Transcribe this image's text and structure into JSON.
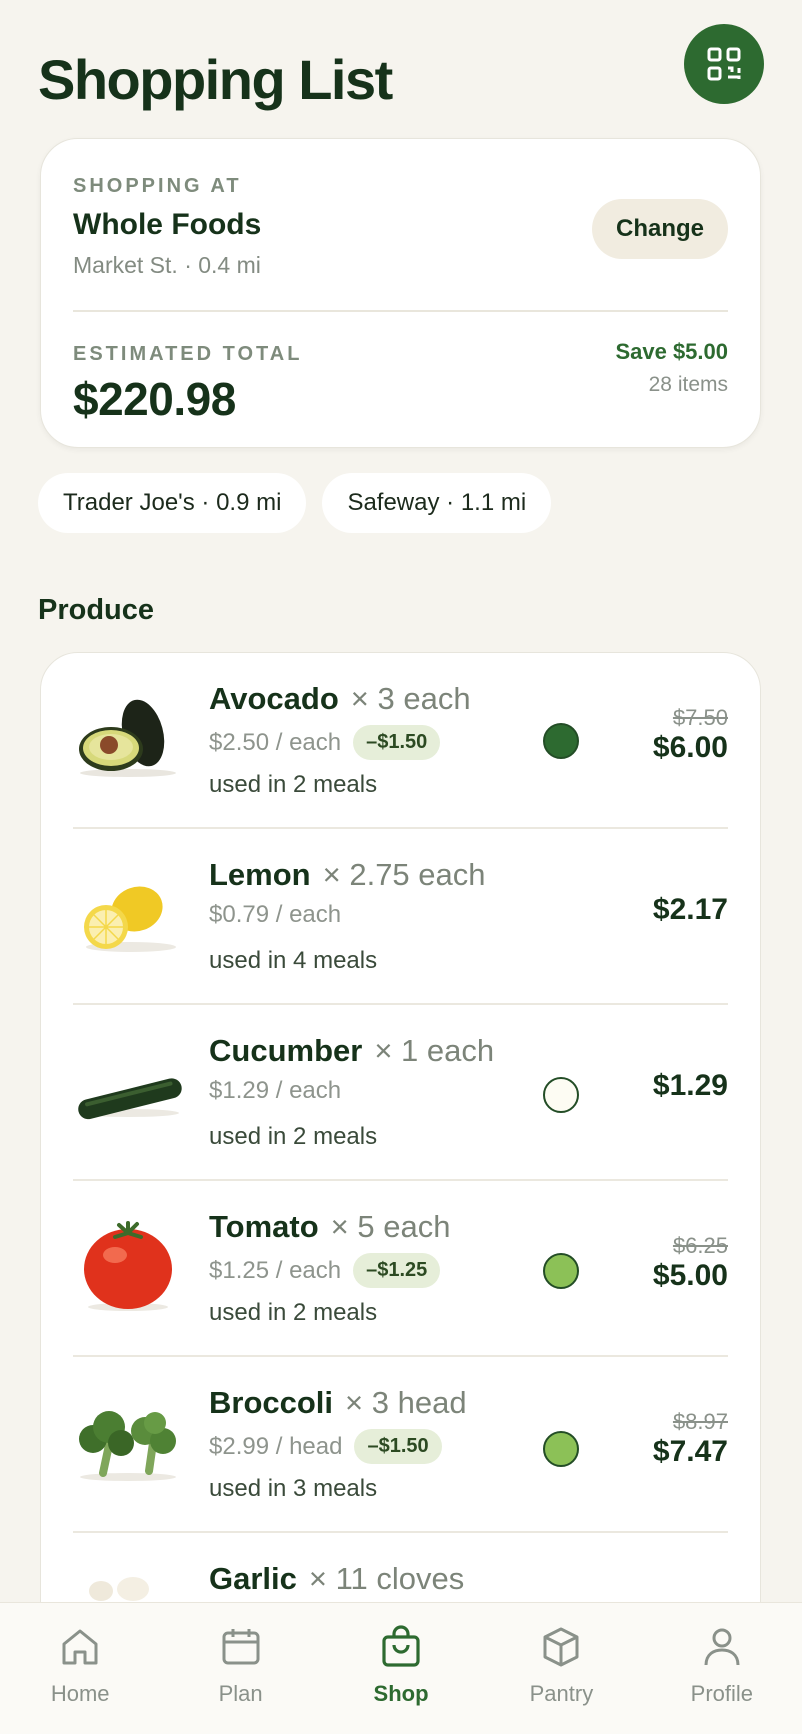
{
  "header": {
    "title": "Shopping List",
    "qr_icon": "qr-code-icon"
  },
  "store_card": {
    "eyebrow": "SHOPPING AT",
    "store_name": "Whole Foods",
    "store_sub": "Market St. · 0.4 mi",
    "change_label": "Change",
    "total_eyebrow": "ESTIMATED TOTAL",
    "total": "$220.98",
    "savings": "Save $5.00",
    "items_count": "28 items"
  },
  "alt_stores": [
    "Trader Joe's · 0.9 mi",
    "Safeway · 1.1 mi"
  ],
  "section": {
    "title": "Produce"
  },
  "items": [
    {
      "name": "Avocado",
      "qty": "× 3 each",
      "unit_price": "$2.50 / each",
      "discount": "–$1.50",
      "meals": "used in 2 meals",
      "status": "filled-dark",
      "old_price": "$7.50",
      "price": "$6.00"
    },
    {
      "name": "Lemon",
      "qty": "× 2.75 each",
      "unit_price": "$0.79 / each",
      "discount": "",
      "meals": "used in 4 meals",
      "status": "none",
      "old_price": "",
      "price": "$2.17"
    },
    {
      "name": "Cucumber",
      "qty": "× 1 each",
      "unit_price": "$1.29 / each",
      "discount": "",
      "meals": "used in 2 meals",
      "status": "empty",
      "old_price": "",
      "price": "$1.29"
    },
    {
      "name": "Tomato",
      "qty": "× 5 each",
      "unit_price": "$1.25 / each",
      "discount": "–$1.25",
      "meals": "used in 2 meals",
      "status": "filled-light",
      "old_price": "$6.25",
      "price": "$5.00"
    },
    {
      "name": "Broccoli",
      "qty": "× 3 head",
      "unit_price": "$2.99 / head",
      "discount": "–$1.50",
      "meals": "used in 3 meals",
      "status": "filled-light",
      "old_price": "$8.97",
      "price": "$7.47"
    },
    {
      "name": "Garlic",
      "qty": "× 11 cloves"
    }
  ],
  "colors": {
    "accent": "#2d6a30",
    "status_dark": "#2d6a30",
    "status_light": "#8cc157",
    "status_empty": "#fdfcf3"
  },
  "tabs": [
    {
      "label": "Home",
      "icon": "home-icon",
      "active": false
    },
    {
      "label": "Plan",
      "icon": "calendar-icon",
      "active": false
    },
    {
      "label": "Shop",
      "icon": "shopping-bag-icon",
      "active": true
    },
    {
      "label": "Pantry",
      "icon": "box-icon",
      "active": false
    },
    {
      "label": "Profile",
      "icon": "user-icon",
      "active": false
    }
  ]
}
